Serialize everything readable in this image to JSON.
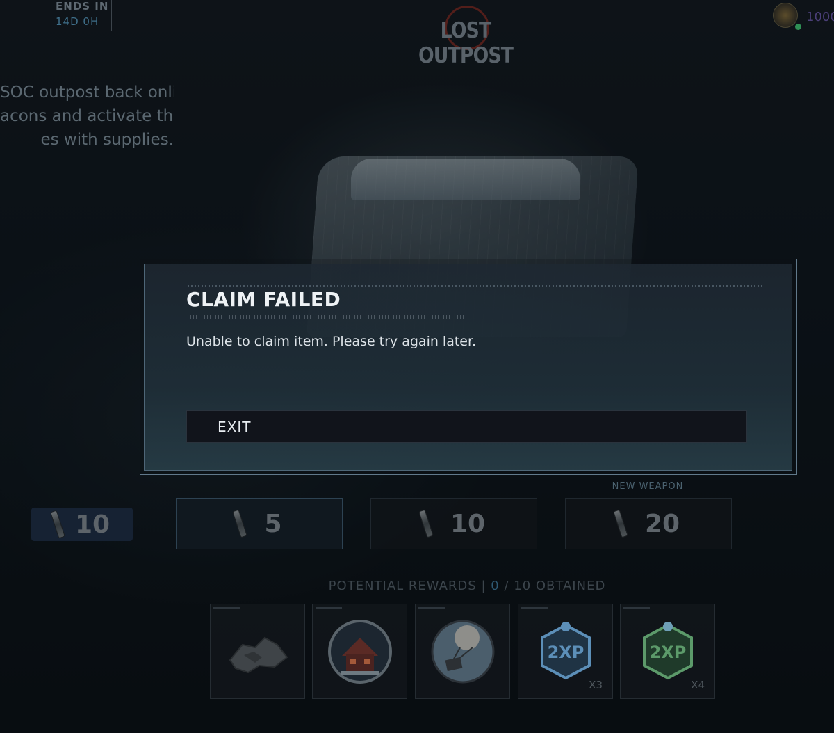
{
  "event": {
    "title": "LOST OUTPOST",
    "ends_label": "ENDS IN",
    "ends_value": "14D 0H",
    "description_lines": [
      "SOC outpost back online.",
      "acons and activate them",
      "es with supplies."
    ]
  },
  "currency": {
    "value": "1000"
  },
  "modal": {
    "title": "CLAIM FAILED",
    "message": "Unable to claim item. Please try again later.",
    "exit_label": "EXIT"
  },
  "tiers": [
    {
      "count": "10"
    },
    {
      "count": "5"
    },
    {
      "count": "10"
    },
    {
      "count": "20",
      "badge": "NEW WEAPON"
    }
  ],
  "rewards": {
    "header_label": "POTENTIAL REWARDS",
    "separator": "|",
    "obtained_count": "0",
    "slash": "/",
    "total_label": "10 OBTAINED",
    "items": [
      {
        "icon": "camo-icon"
      },
      {
        "icon": "cabin-emblem-icon"
      },
      {
        "icon": "supply-drop-icon"
      },
      {
        "icon": "double-xp-blue-icon",
        "text": "2XP",
        "qty": "X3"
      },
      {
        "icon": "double-xp-green-icon",
        "text": "2XP",
        "qty": "X4"
      }
    ]
  },
  "colors": {
    "modal_bg": "#1f2e38",
    "accent_blue": "#2e5872",
    "xp_blue": "#5c8fb8",
    "xp_green": "#5c9a6a"
  }
}
